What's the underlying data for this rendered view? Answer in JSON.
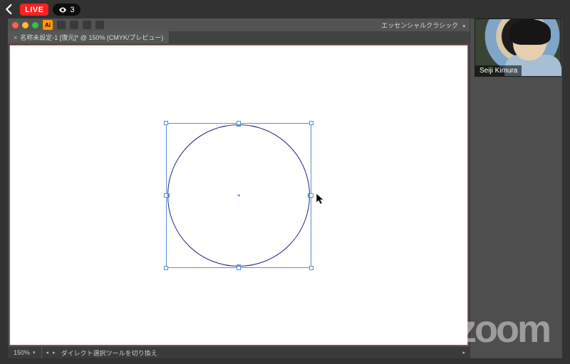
{
  "stream": {
    "live_label": "LIVE",
    "viewer_count": "3"
  },
  "illustrator": {
    "app_short": "Ai",
    "workspace": "エッセンシャルクラシック",
    "tab_title": "名称未設定-1 [復元]* @ 150% (CMYK/プレビュー)",
    "zoom": "150%",
    "status_message": "ダイレクト選択ツールを切り換え"
  },
  "participant": {
    "name": "Seiji Kimura"
  },
  "watermark": "zoom"
}
